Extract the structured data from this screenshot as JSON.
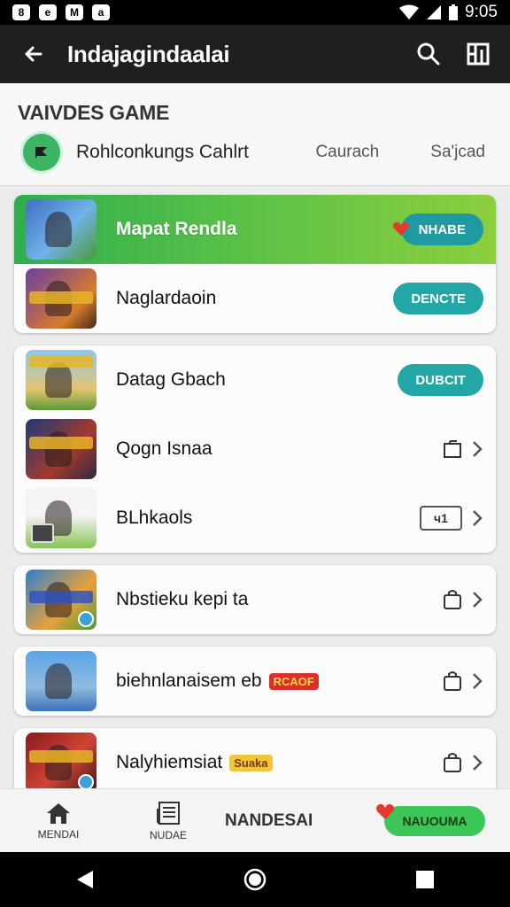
{
  "status": {
    "time": "9:05",
    "left_icons": [
      "8",
      "e",
      "M",
      "a"
    ]
  },
  "appbar": {
    "title": "Indajagindaalai"
  },
  "filters": {
    "section_title": "VAIVDES GAME",
    "active_chip": "Rohlconkungs Cahlrt",
    "option_1": "Caurach",
    "option_2": "Sa'jcad"
  },
  "cards": [
    {
      "rows": [
        {
          "title": "Mapat Rendla",
          "action": "NHABE",
          "featured": true
        },
        {
          "title": "Naglardaoin",
          "action": "DENCTE"
        }
      ]
    },
    {
      "rows": [
        {
          "title": "Datag Gbach",
          "action": "DUBCIT"
        },
        {
          "title": "Qogn Isnaa"
        },
        {
          "title": "BLhkaols",
          "box_label": "ч1"
        }
      ]
    },
    {
      "rows": [
        {
          "title": "Nbstieku kepi ta"
        }
      ]
    },
    {
      "rows": [
        {
          "title": "biehnlanaisem eb",
          "tag": "RCAOF"
        }
      ]
    },
    {
      "rows": [
        {
          "title": "Nalyhiemsiat",
          "tag": "Suaka"
        }
      ]
    }
  ],
  "bottom_nav": {
    "home_label": "MENDAI",
    "news_label": "NUDAE",
    "center_label": "NANDESAI",
    "cta_label": "NAUOUMA"
  },
  "colors": {
    "accent_teal": "#23a7a6",
    "accent_green": "#3cc658",
    "appbar": "#1f1f1f"
  }
}
